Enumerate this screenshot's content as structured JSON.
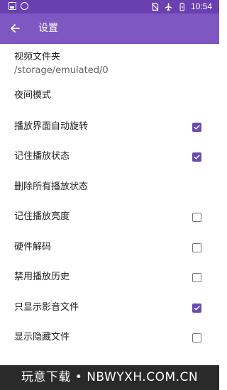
{
  "status_bar": {
    "time": "10:54"
  },
  "app_bar": {
    "title": "设置"
  },
  "settings": [
    {
      "label": "视频文件夹",
      "summary": "/storage/emulated/0"
    },
    {
      "label": "夜间模式"
    },
    {
      "label": "播放界面自动旋转",
      "checked": true
    },
    {
      "label": "记住播放状态",
      "checked": true
    },
    {
      "label": "删除所有播放状态"
    },
    {
      "label": "记住播放亮度",
      "checked": false
    },
    {
      "label": "硬件解码",
      "checked": false
    },
    {
      "label": "禁用播放历史",
      "checked": false
    },
    {
      "label": "只显示影音文件",
      "checked": true
    },
    {
      "label": "显示隐藏文件",
      "checked": false
    }
  ],
  "watermark": {
    "text": "玩意下载 • NBWYXH.COM.CN"
  },
  "colors": {
    "status_bar": "#6a3fb0",
    "app_bar": "#7e57c2",
    "checkbox_on": "#6a4bb3"
  }
}
